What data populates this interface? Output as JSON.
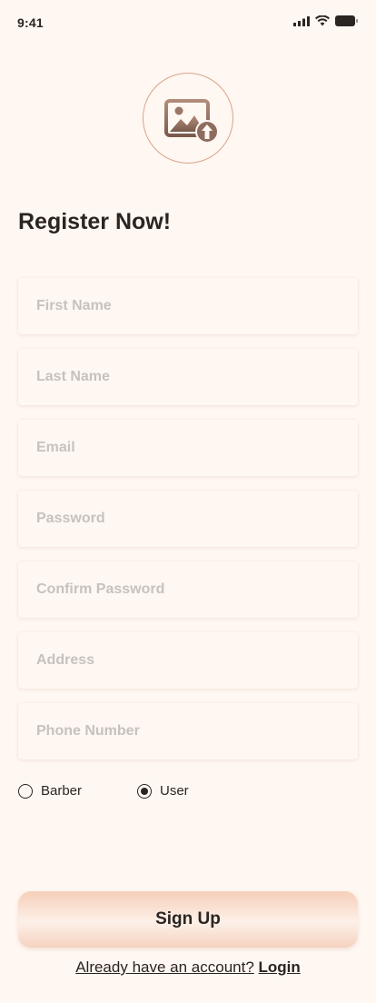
{
  "status_bar": {
    "time": "9:41",
    "icons": [
      "signal-icon",
      "wifi-icon",
      "battery-icon"
    ]
  },
  "avatar_upload": {
    "icon": "image-upload-icon"
  },
  "title": "Register Now!",
  "fields": [
    {
      "name": "first-name-input",
      "placeholder": "First Name",
      "value": ""
    },
    {
      "name": "last-name-input",
      "placeholder": "Last Name",
      "value": ""
    },
    {
      "name": "email-input",
      "placeholder": "Email",
      "value": ""
    },
    {
      "name": "password-input",
      "placeholder": "Password",
      "value": ""
    },
    {
      "name": "confirm-password-input",
      "placeholder": "Confirm Password",
      "value": ""
    },
    {
      "name": "address-input",
      "placeholder": "Address",
      "value": ""
    },
    {
      "name": "phone-number-input",
      "placeholder": "Phone Number",
      "value": ""
    }
  ],
  "role": {
    "options": [
      "Barber",
      "User"
    ],
    "selected": "User"
  },
  "signup_button": "Sign Up",
  "login_prompt": "Already have an account?",
  "login_link": "Login",
  "colors": {
    "background": "#fff7f2",
    "accent": "#d8a58a",
    "text": "#2b2522",
    "placeholder": "#c6c2bf"
  }
}
